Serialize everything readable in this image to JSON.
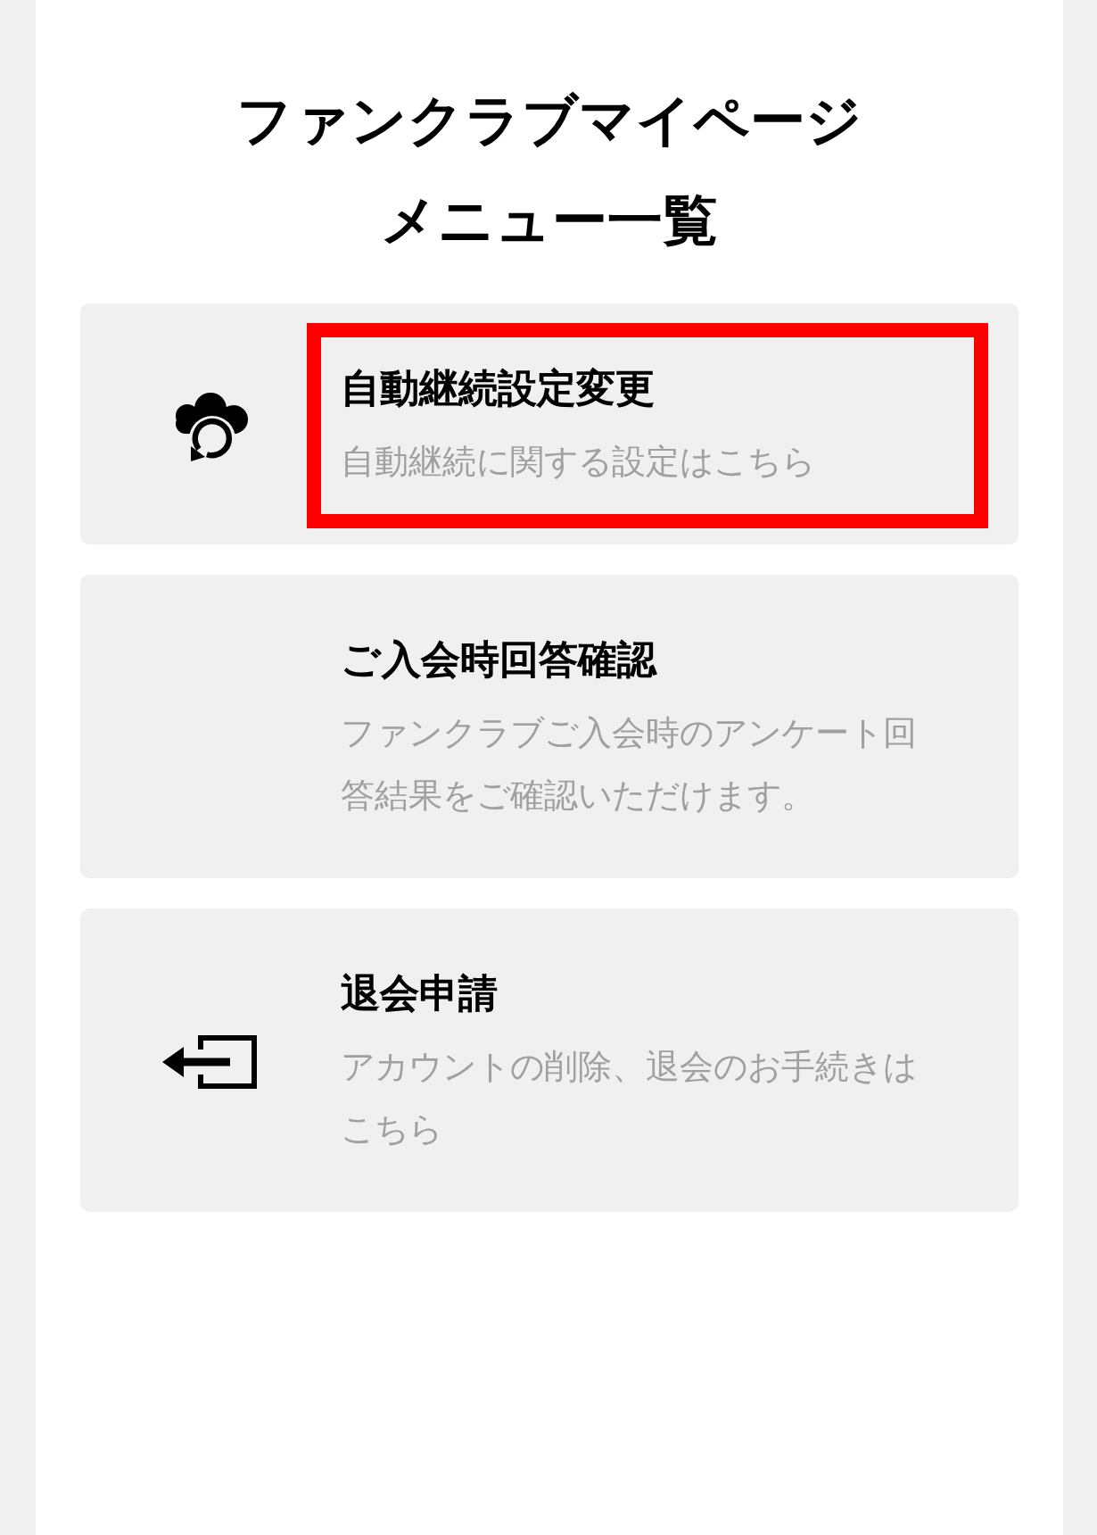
{
  "page": {
    "title_lines": [
      "ファンクラブマイページ",
      "メニュー一覧"
    ]
  },
  "menu_items": [
    {
      "kind": "auto_renewal",
      "title": "自動継続設定変更",
      "description": "自動継続に関する設定はこちら",
      "highlighted": true
    },
    {
      "kind": "signup_answers",
      "title": "ご入会時回答確認",
      "description": "ファンクラブご入会時のアンケート回答結果をご確認いただけます。",
      "highlighted": false
    },
    {
      "kind": "withdrawal",
      "title": "退会申請",
      "description": "アカウントの削除、退会のお手続きはこちら",
      "highlighted": false
    }
  ]
}
